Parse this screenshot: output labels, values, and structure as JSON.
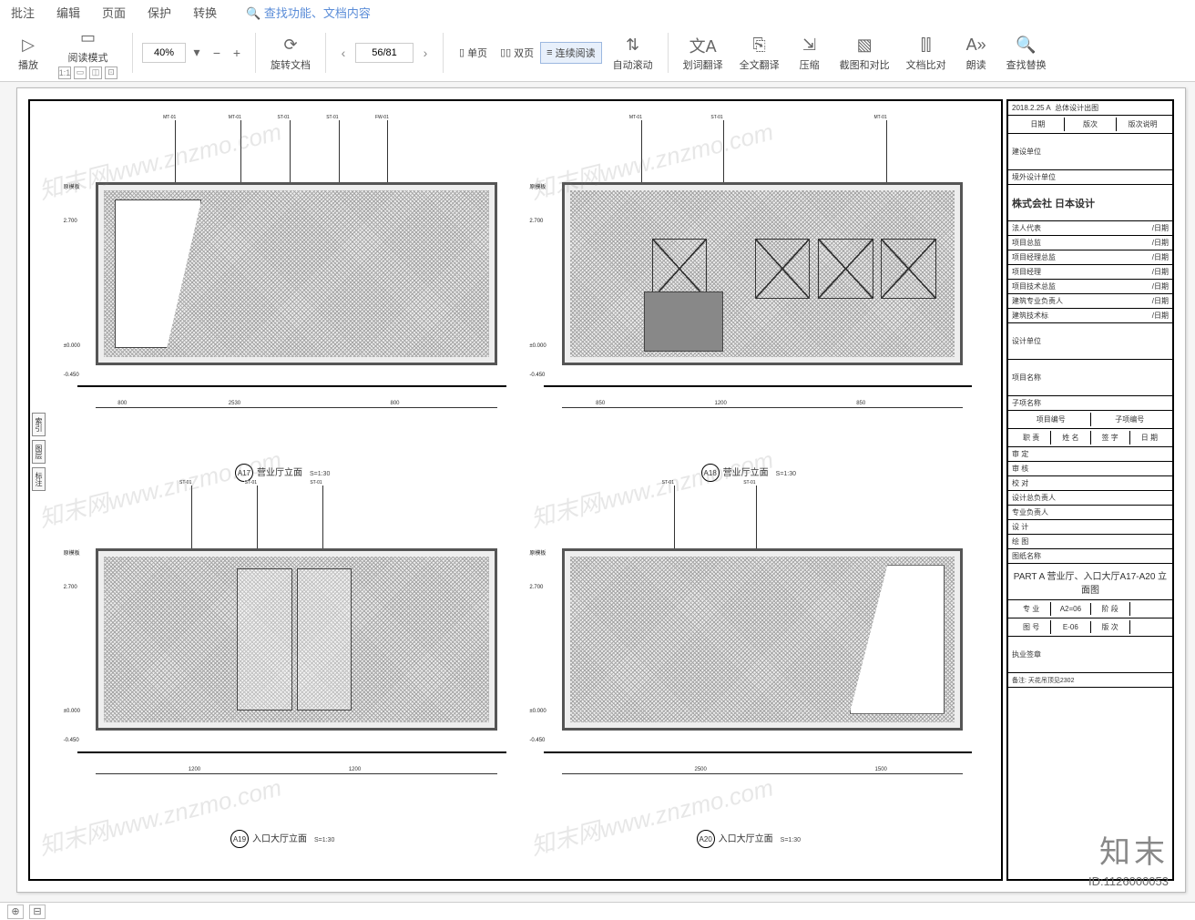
{
  "menu": {
    "items": [
      "批注",
      "编辑",
      "页面",
      "保护",
      "转换"
    ],
    "search_hint": "查找功能、文档内容"
  },
  "toolbar": {
    "play": "播放",
    "read_mode": "阅读模式",
    "zoom_value": "40%",
    "rotate": "旋转文档",
    "single": "单页",
    "double": "双页",
    "continuous": "连续阅读",
    "autoscroll": "自动滚动",
    "word_trans": "划词翻译",
    "full_trans": "全文翻译",
    "compress": "压缩",
    "screenshot": "截图和对比",
    "filecompare": "文档比对",
    "readaloud": "朗读",
    "findreplace": "查找替换",
    "page_value": "56/81"
  },
  "drawing": {
    "elevations": [
      {
        "tag": "A17",
        "title": "营业厅立面",
        "scale": "S=1:30"
      },
      {
        "tag": "A18",
        "title": "营业厅立面",
        "scale": "S=1:30"
      },
      {
        "tag": "A19",
        "title": "入口大厅立面",
        "scale": "S=1:30"
      },
      {
        "tag": "A20",
        "title": "入口大厅立面",
        "scale": "S=1:30"
      }
    ],
    "levels": {
      "top": "原模板",
      "h1": "2.700",
      "base": "±0.000",
      "below": "-0.450"
    }
  },
  "titleblock": {
    "header_date": "日期",
    "header_rev": "版次",
    "header_desc": "版次说明",
    "top_right": "总体设计出图",
    "top_code": "2018.2.25  A",
    "construction_unit": "建设单位",
    "overseas_unit": "境外设计单位",
    "company": "株式会社 日本设计",
    "rows": [
      "法人代表",
      "项目总监",
      "项目经理总监",
      "项目经理",
      "项目技术总监",
      "建筑专业负责人",
      "建筑技术标"
    ],
    "row_date": "/日期",
    "design_unit": "设计单位",
    "project_name": "项目名称",
    "subproject": "子项名称",
    "proj_no": "项目编号",
    "sub_no": "子项编号",
    "pos": "职  责",
    "name": "姓 名",
    "sign": "签  字",
    "date": "日  期",
    "approve": "审  定",
    "review": "审  核",
    "check": "校  对",
    "design": "设  计",
    "draw": "绘  图",
    "design_lead": "设计总负责人",
    "prof_lead": "专业负责人",
    "sheet_label": "图纸名称",
    "sheet_name": "PART A  营业厅、入口大厅A17-A20 立面图",
    "spec": "专  业",
    "spec_val": "A2=06",
    "stage": "阶  段",
    "sheet_no": "图  号",
    "sheet_no_val": "E-06",
    "rev": "版  次",
    "seal": "执业签章",
    "note": "备注: 天花吊顶见2302"
  },
  "footer": {
    "brand": "知末",
    "id": "ID:1126000053"
  },
  "watermark": "知末网www.znzmo.com"
}
